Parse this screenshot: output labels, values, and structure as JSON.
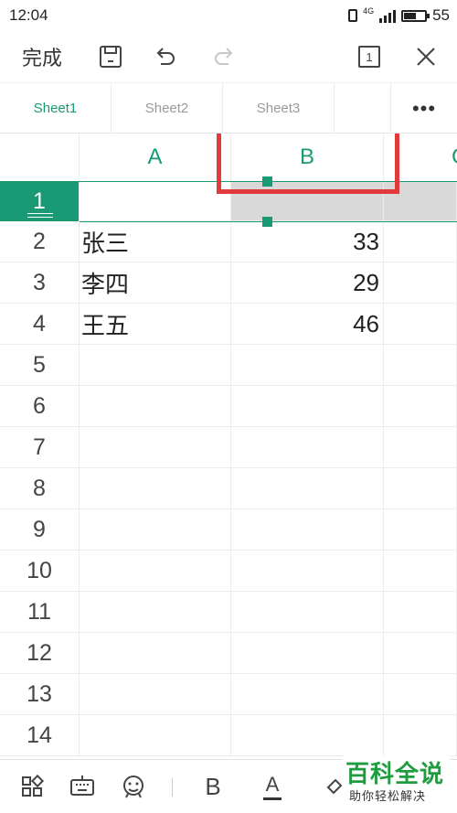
{
  "status_bar": {
    "time": "12:04",
    "network": "4G",
    "battery": "55"
  },
  "toolbar": {
    "done_label": "完成",
    "icons": [
      "save-icon",
      "undo-icon",
      "redo-icon",
      "sheet-count-icon",
      "close-icon"
    ],
    "sheet_count": "1"
  },
  "sheet_tabs": {
    "tabs": [
      {
        "label": "Sheet1",
        "active": true
      },
      {
        "label": "Sheet2",
        "active": false
      },
      {
        "label": "Sheet3",
        "active": false
      }
    ],
    "more_label": "•••"
  },
  "grid": {
    "columns": [
      "A",
      "B",
      "C"
    ],
    "rows": [
      {
        "row": "1",
        "A": "",
        "B": ""
      },
      {
        "row": "2",
        "A": "张三",
        "B": "33"
      },
      {
        "row": "3",
        "A": "李四",
        "B": "29"
      },
      {
        "row": "4",
        "A": "王五",
        "B": "46"
      },
      {
        "row": "5",
        "A": "",
        "B": ""
      },
      {
        "row": "6",
        "A": "",
        "B": ""
      },
      {
        "row": "7",
        "A": "",
        "B": ""
      },
      {
        "row": "8",
        "A": "",
        "B": ""
      },
      {
        "row": "9",
        "A": "",
        "B": ""
      },
      {
        "row": "10",
        "A": "",
        "B": ""
      },
      {
        "row": "11",
        "A": "",
        "B": ""
      },
      {
        "row": "12",
        "A": "",
        "B": ""
      },
      {
        "row": "13",
        "A": "",
        "B": ""
      },
      {
        "row": "14",
        "A": "",
        "B": ""
      }
    ],
    "selected_row": "1",
    "selected_cell": "B1"
  },
  "bottom_bar": {
    "icons": [
      "apps-icon",
      "keyboard-icon",
      "emoji-icon",
      "bold-icon",
      "font-color-icon",
      "fill-color-icon"
    ],
    "bold_label": "B",
    "font_color_label": "A"
  },
  "watermark": {
    "title": "百科全说",
    "subtitle": "助你轻松解决"
  },
  "colors": {
    "accent": "#1a9a74",
    "highlight": "#e03a3a",
    "selection": "#d9d9d9"
  }
}
